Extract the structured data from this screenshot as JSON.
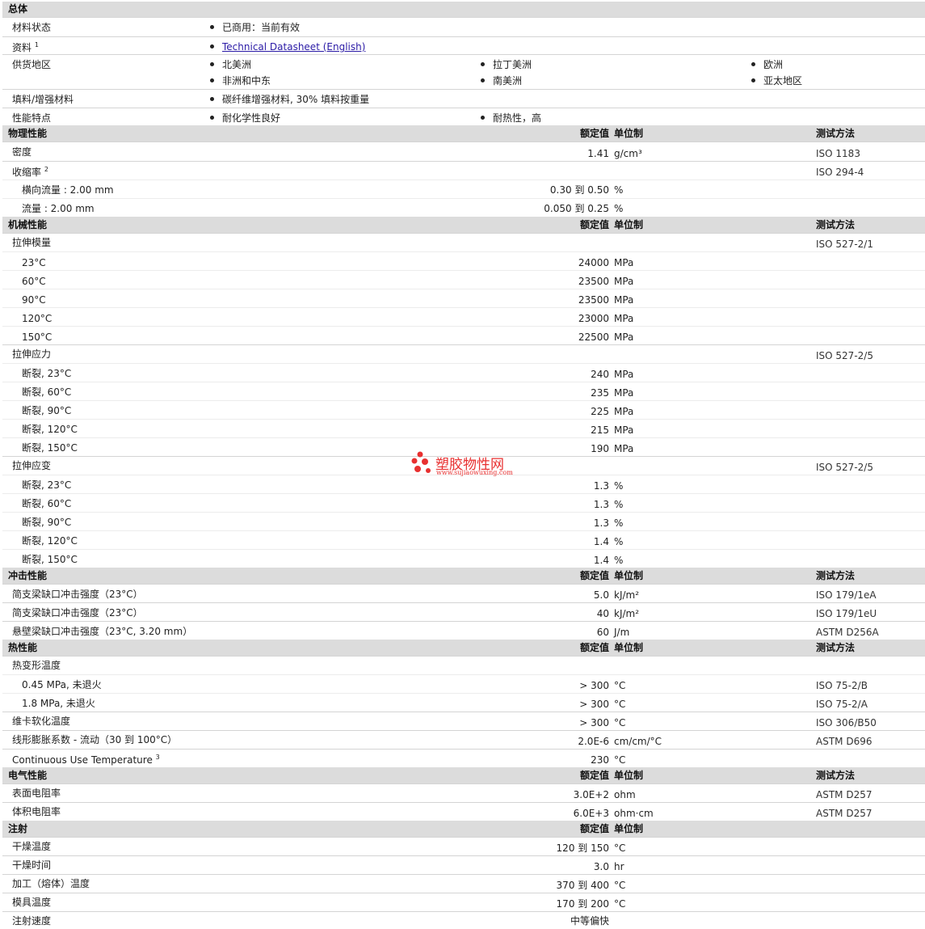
{
  "general": {
    "title": "总体",
    "material_status": {
      "label": "材料状态",
      "value": "已商用：当前有效"
    },
    "literature": {
      "label": "资料",
      "sup": "1",
      "link": "Technical Datasheet (English)"
    },
    "availability": {
      "label": "供货地区",
      "items": [
        "北美洲",
        "拉丁美洲",
        "欧洲",
        "非洲和中东",
        "南美洲",
        "亚太地区"
      ]
    },
    "filler": {
      "label": "填料/增强材料",
      "value": "碳纤维增强材料, 30% 填料按重量"
    },
    "features": {
      "label": "性能特点",
      "items": [
        "耐化学性良好",
        "耐热性，高"
      ]
    }
  },
  "headers": {
    "nominal": "额定值",
    "unit": "单位制",
    "test": "测试方法"
  },
  "physical": {
    "title": "物理性能",
    "density": {
      "label": "密度",
      "value": "1.41",
      "unit": "g/cm³",
      "test": "ISO 1183"
    },
    "shrinkage": {
      "label": "收缩率",
      "sup": "2",
      "test": "ISO 294-4"
    },
    "shrink_transverse": {
      "label": "横向流量 : 2.00 mm",
      "value": "0.30 到  0.50",
      "unit": "%"
    },
    "shrink_flow": {
      "label": "流量 : 2.00 mm",
      "value": "0.050 到  0.25",
      "unit": "%"
    }
  },
  "mechanical": {
    "title": "机械性能",
    "tensile_modulus": {
      "label": "拉伸模量",
      "test": "ISO 527-2/1"
    },
    "modulus_rows": [
      {
        "label": "23°C",
        "value": "24000",
        "unit": "MPa"
      },
      {
        "label": "60°C",
        "value": "23500",
        "unit": "MPa"
      },
      {
        "label": "90°C",
        "value": "23500",
        "unit": "MPa"
      },
      {
        "label": "120°C",
        "value": "23000",
        "unit": "MPa"
      },
      {
        "label": "150°C",
        "value": "22500",
        "unit": "MPa"
      }
    ],
    "tensile_stress": {
      "label": "拉伸应力",
      "test": "ISO 527-2/5"
    },
    "stress_rows": [
      {
        "label": "断裂, 23°C",
        "value": "240",
        "unit": "MPa"
      },
      {
        "label": "断裂, 60°C",
        "value": "235",
        "unit": "MPa"
      },
      {
        "label": "断裂, 90°C",
        "value": "225",
        "unit": "MPa"
      },
      {
        "label": "断裂, 120°C",
        "value": "215",
        "unit": "MPa"
      },
      {
        "label": "断裂, 150°C",
        "value": "190",
        "unit": "MPa"
      }
    ],
    "tensile_strain": {
      "label": "拉伸应变",
      "test": "ISO 527-2/5"
    },
    "strain_rows": [
      {
        "label": "断裂, 23°C",
        "value": "1.3",
        "unit": "%"
      },
      {
        "label": "断裂, 60°C",
        "value": "1.3",
        "unit": "%"
      },
      {
        "label": "断裂, 90°C",
        "value": "1.3",
        "unit": "%"
      },
      {
        "label": "断裂, 120°C",
        "value": "1.4",
        "unit": "%"
      },
      {
        "label": "断裂, 150°C",
        "value": "1.4",
        "unit": "%"
      }
    ]
  },
  "impact": {
    "title": "冲击性能",
    "rows": [
      {
        "label": "简支梁缺口冲击强度（23°C）",
        "value": "5.0",
        "unit": "kJ/m²",
        "test": "ISO 179/1eA"
      },
      {
        "label": "简支梁缺口冲击强度（23°C）",
        "value": "40",
        "unit": "kJ/m²",
        "test": "ISO 179/1eU"
      },
      {
        "label": "悬壁梁缺口冲击强度（23°C, 3.20 mm）",
        "value": "60",
        "unit": "J/m",
        "test": "ASTM D256A"
      }
    ]
  },
  "thermal": {
    "title": "热性能",
    "hdt": {
      "label": "热变形温度"
    },
    "hdt_rows": [
      {
        "label": "0.45 MPa, 未退火",
        "value": "> 300",
        "unit": "°C",
        "test": "ISO 75-2/B"
      },
      {
        "label": "1.8 MPa, 未退火",
        "value": "> 300",
        "unit": "°C",
        "test": "ISO 75-2/A"
      }
    ],
    "vicat": {
      "label": "维卡软化温度",
      "value": "> 300",
      "unit": "°C",
      "test": "ISO 306/B50"
    },
    "clte": {
      "label": "线形膨胀系数  - 流动（30 到  100°C）",
      "value": "2.0E-6",
      "unit": "cm/cm/°C",
      "test": "ASTM D696"
    },
    "cut": {
      "label": "Continuous Use Temperature",
      "sup": "3",
      "value": "230",
      "unit": "°C"
    }
  },
  "electrical": {
    "title": "电气性能",
    "rows": [
      {
        "label": "表面电阻率",
        "value": "3.0E+2",
        "unit": "ohm",
        "test": "ASTM D257"
      },
      {
        "label": "体积电阻率",
        "value": "6.0E+3",
        "unit": "ohm·cm",
        "test": "ASTM D257"
      }
    ]
  },
  "injection": {
    "title": "注射",
    "rows": [
      {
        "label": "干燥温度",
        "value": "120 到  150",
        "unit": "°C"
      },
      {
        "label": "干燥时间",
        "value": "3.0",
        "unit": "hr"
      },
      {
        "label": "加工（熔体）温度",
        "value": "370 到  400",
        "unit": "°C"
      },
      {
        "label": "模具温度",
        "value": "170 到  200",
        "unit": "°C"
      },
      {
        "label": "注射速度",
        "value": "中等偏快",
        "unit": ""
      }
    ]
  },
  "watermark": {
    "title": "塑胶物性网",
    "url": "www.sujiaowuxing.com"
  },
  "colors": {
    "section_bg": "#dcdcdc",
    "link": "#2a1aa6",
    "watermark": "#e83030"
  }
}
